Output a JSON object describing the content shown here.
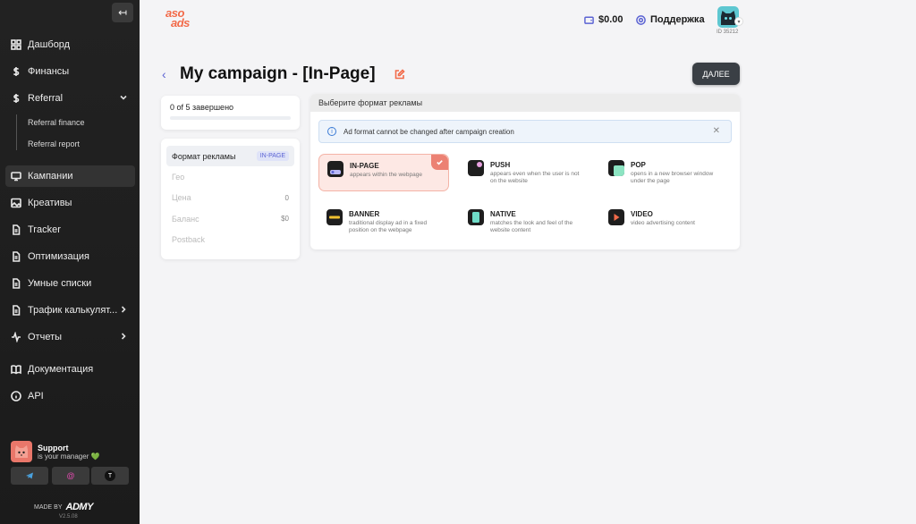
{
  "sidebar": {
    "collapse_icon": "↤",
    "items": [
      {
        "label": "Дашборд",
        "icon": "grid-icon"
      },
      {
        "label": "Финансы",
        "icon": "dollar-icon"
      },
      {
        "label": "Referral",
        "icon": "dollar-icon"
      },
      {
        "label": "Кампании",
        "icon": "monitor-icon"
      },
      {
        "label": "Креативы",
        "icon": "image-icon"
      },
      {
        "label": "Tracker",
        "icon": "file-icon"
      },
      {
        "label": "Оптимизация",
        "icon": "file-icon"
      },
      {
        "label": "Умные списки",
        "icon": "file-icon"
      },
      {
        "label": "Трафик калькулят...",
        "icon": "file-icon"
      },
      {
        "label": "Отчеты",
        "icon": "activity-icon"
      },
      {
        "label": "Документация",
        "icon": "book-icon"
      },
      {
        "label": "API",
        "icon": "info-icon"
      }
    ],
    "sub_items": [
      "Referral finance",
      "Referral report"
    ],
    "support": {
      "title": "Support",
      "subtitle": "is your manager 💚"
    },
    "socials": [
      "telegram-icon",
      "at-icon",
      "t-icon"
    ],
    "made_by": "MADE BY",
    "made_by_logo": "ADMY",
    "version": "V2.5.08"
  },
  "header": {
    "logo_top": "aso",
    "logo_bottom": "ads",
    "balance": "$0.00",
    "support": "Поддержка",
    "user_id": "ID 35212"
  },
  "page": {
    "back_icon": "‹",
    "title": "My campaign - [In-Page]",
    "next_button": "ДАЛЕЕ"
  },
  "progress": {
    "text": "0 of 5 завершено",
    "value": 0
  },
  "steps": [
    {
      "label": "Формат рекламы",
      "badge": "IN-PAGE",
      "value": ""
    },
    {
      "label": "Гео",
      "badge": "",
      "value": ""
    },
    {
      "label": "Цена",
      "badge": "",
      "value": "0"
    },
    {
      "label": "Баланс",
      "badge": "",
      "value": "$0"
    },
    {
      "label": "Postback",
      "badge": "",
      "value": ""
    }
  ],
  "format_panel": {
    "title": "Выберите формат рекламы",
    "info": "Ad format cannot be changed after campaign creation",
    "close_icon": "✕",
    "formats": [
      {
        "name": "IN-PAGE",
        "desc": "appears within the webpage",
        "selected": true
      },
      {
        "name": "PUSH",
        "desc": "appears even when the user is not on the website",
        "selected": false
      },
      {
        "name": "POP",
        "desc": "opens in a new browser window under the page",
        "selected": false
      },
      {
        "name": "BANNER",
        "desc": "traditional display ad in a fixed position on the webpage",
        "selected": false
      },
      {
        "name": "NATIVE",
        "desc": "matches the look and feel of the website content",
        "selected": false
      },
      {
        "name": "VIDEO",
        "desc": "video advertising content",
        "selected": false
      }
    ]
  },
  "colors": {
    "accent": "#5b63d3",
    "brand": "#f26b4a",
    "sidebar": "#1f1f1f"
  }
}
